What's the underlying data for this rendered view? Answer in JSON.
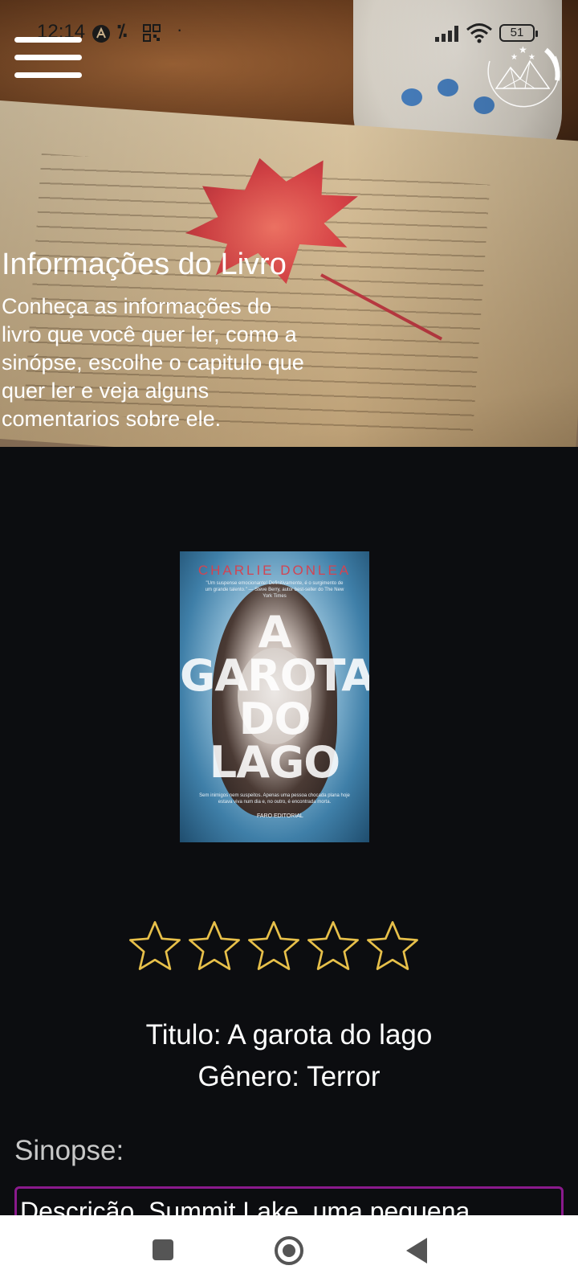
{
  "status_bar": {
    "time": "12:14",
    "battery": "51",
    "icons": [
      "a-icon",
      "percent-icon",
      "grid-icon",
      "dot-icon",
      "signal-icon",
      "wifi-icon",
      "battery-icon"
    ]
  },
  "header": {
    "menu_icon": "hamburger-menu-icon",
    "logo_icon": "mountain-logo-icon"
  },
  "hero": {
    "title": "Informações do Livro",
    "description": "Conheça as informações do livro que você quer ler, como a sinópse, escolhe o capitulo que quer ler e veja alguns comentarios sobre ele."
  },
  "book": {
    "cover": {
      "author": "CHARLIE DONLEA",
      "blurb": "\"Um suspense emocionante! Definitivamente, é o surgimento de um grande talento.\" — Steve Berry, autor best-seller do The New York Times",
      "title_lines": [
        "A",
        "GAROTA",
        "DO",
        "LAGO"
      ],
      "tagline": "Sem inimigos nem suspeitos. Apenas uma pessoa chocada plana hoje estava viva num dia e, no outro, é encontrada morta.",
      "publisher": "FARO EDITORIAL"
    },
    "rating": {
      "value": 0,
      "max": 5,
      "star_color": "#e7c04a"
    },
    "title_line": "Titulo: A garota do lago",
    "genre_line": "Gênero: Terror",
    "synopsis_label": "Sinopse:",
    "synopsis_text": "Descrição. Summit Lake, uma pequena"
  },
  "colors": {
    "background": "#0c0d10",
    "synopsis_border": "#8a1a8c",
    "navbar": "#ffffff"
  },
  "navigation": {
    "recent_icon": "square-recent-icon",
    "home_icon": "circle-home-icon",
    "back_icon": "triangle-back-icon"
  }
}
